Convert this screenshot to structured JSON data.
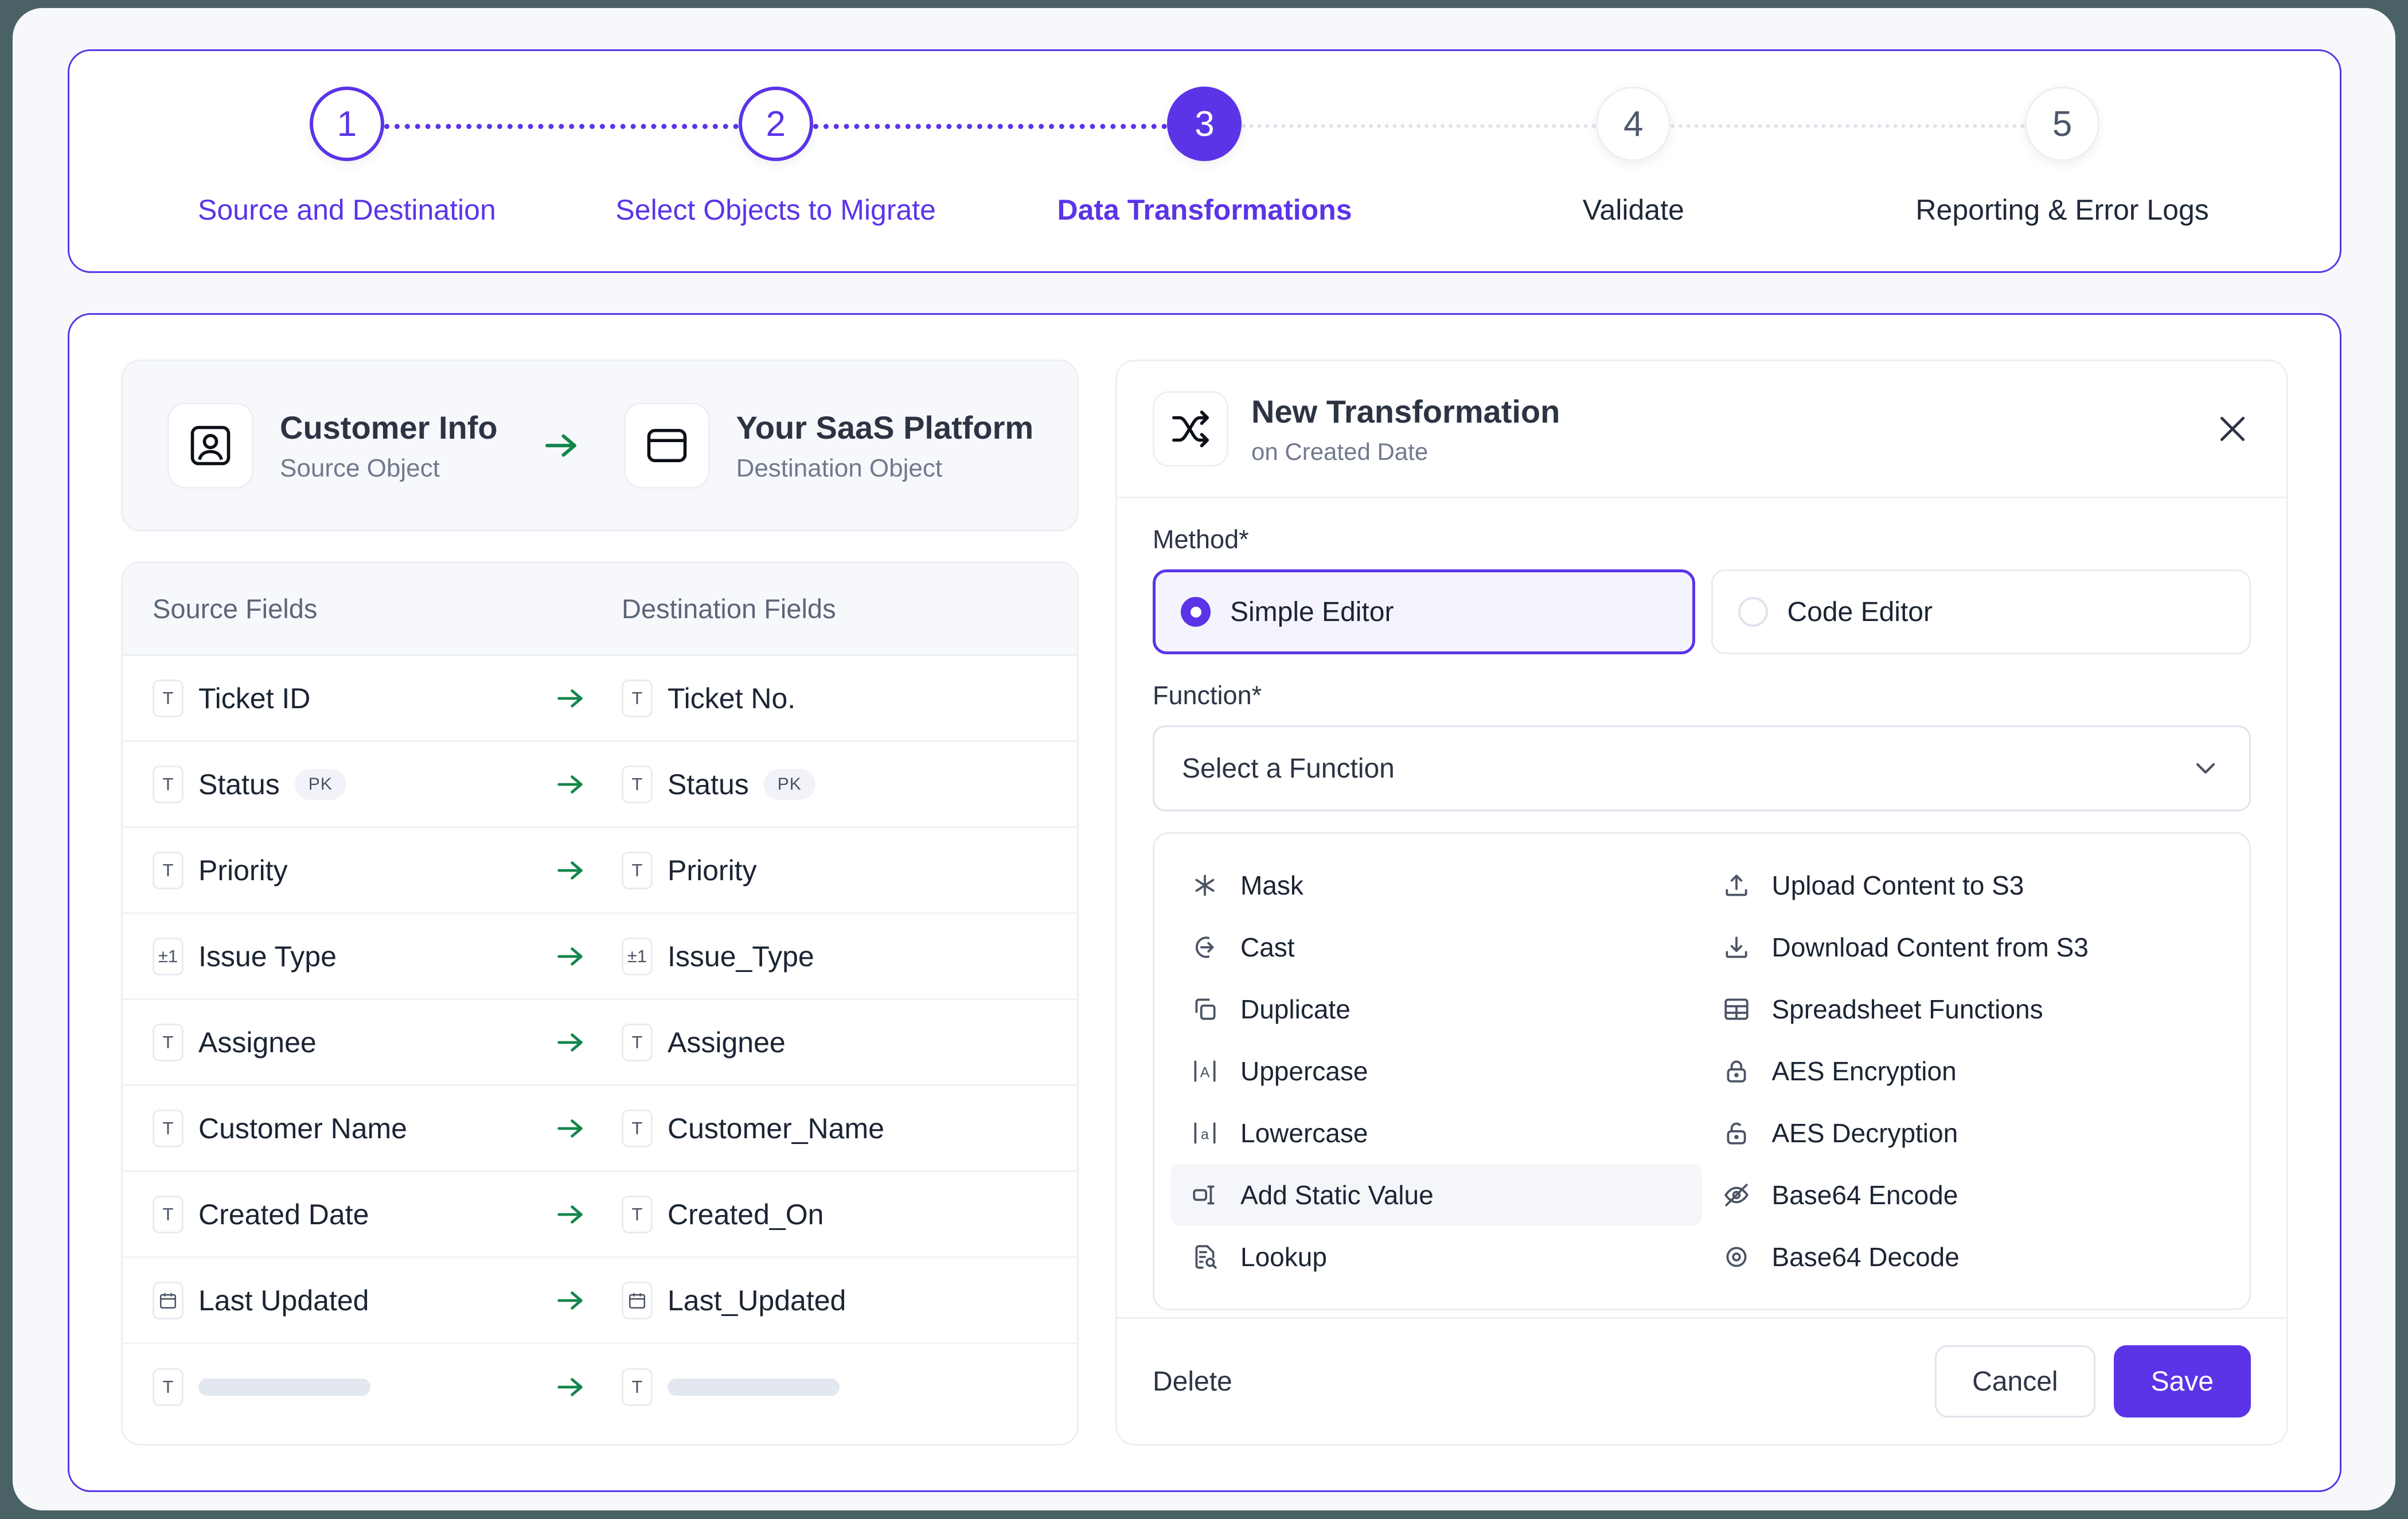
{
  "theme": {
    "accent": "#5b34e8",
    "arrow_green": "#13864b",
    "page_bg": "#4a6166",
    "surface": "#f6f8fc"
  },
  "stepper": {
    "steps": [
      {
        "number": "1",
        "label": "Source and Destination",
        "state": "done"
      },
      {
        "number": "2",
        "label": "Select Objects to Migrate",
        "state": "done"
      },
      {
        "number": "3",
        "label": "Data Transformations",
        "state": "active"
      },
      {
        "number": "4",
        "label": "Validate",
        "state": "todo"
      },
      {
        "number": "5",
        "label": "Reporting & Error Logs",
        "state": "todo"
      }
    ]
  },
  "mapping": {
    "source_object": {
      "name": "Customer Info",
      "subtitle": "Source Object",
      "icon": "user-square-icon"
    },
    "destination_object": {
      "name": "Your SaaS Platform",
      "subtitle": "Destination Object",
      "icon": "database-card-icon"
    },
    "columns": {
      "source": "Source Fields",
      "destination": "Destination Fields"
    },
    "rows": [
      {
        "source": {
          "name": "Ticket ID",
          "type": "T",
          "pk": false
        },
        "destination": {
          "name": "Ticket No.",
          "type": "T",
          "pk": false
        }
      },
      {
        "source": {
          "name": "Status",
          "type": "T",
          "pk": true,
          "pk_label": "PK"
        },
        "destination": {
          "name": "Status",
          "type": "T",
          "pk": true,
          "pk_label": "PK"
        }
      },
      {
        "source": {
          "name": "Priority",
          "type": "T",
          "pk": false
        },
        "destination": {
          "name": "Priority",
          "type": "T",
          "pk": false
        }
      },
      {
        "source": {
          "name": "Issue Type",
          "type": "±1",
          "pk": false
        },
        "destination": {
          "name": "Issue_Type",
          "type": "±1",
          "pk": false
        }
      },
      {
        "source": {
          "name": "Assignee",
          "type": "T",
          "pk": false
        },
        "destination": {
          "name": "Assignee",
          "type": "T",
          "pk": false
        }
      },
      {
        "source": {
          "name": "Customer Name",
          "type": "T",
          "pk": false
        },
        "destination": {
          "name": "Customer_Name",
          "type": "T",
          "pk": false
        }
      },
      {
        "source": {
          "name": "Created Date",
          "type": "T",
          "pk": false
        },
        "destination": {
          "name": "Created_On",
          "type": "T",
          "pk": false
        }
      },
      {
        "source": {
          "name": "Last Updated",
          "type": "cal",
          "pk": false
        },
        "destination": {
          "name": "Last_Updated",
          "type": "cal",
          "pk": false
        }
      },
      {
        "source": {
          "name": "",
          "type": "T",
          "pk": false,
          "skeleton": true
        },
        "destination": {
          "name": "",
          "type": "T",
          "pk": false,
          "skeleton": true
        }
      }
    ]
  },
  "transformation_panel": {
    "title": "New Transformation",
    "subtitle": "on Created Date",
    "icon": "shuffle-icon",
    "close_icon": "close-icon",
    "method_label": "Method*",
    "methods": [
      {
        "label": "Simple Editor",
        "selected": true
      },
      {
        "label": "Code Editor",
        "selected": false
      }
    ],
    "function_label": "Function*",
    "function_value": "Select a Function",
    "function_caret": "chevron-down-icon",
    "functions_left": [
      {
        "label": "Mask",
        "icon": "asterisk-icon",
        "highlight": false
      },
      {
        "label": "Cast",
        "icon": "arrow-right-circle-icon",
        "highlight": false
      },
      {
        "label": "Duplicate",
        "icon": "copy-icon",
        "highlight": false
      },
      {
        "label": "Uppercase",
        "icon": "uppercase-a-icon",
        "highlight": false
      },
      {
        "label": "Lowercase",
        "icon": "lowercase-a-icon",
        "highlight": false
      },
      {
        "label": "Add Static Value",
        "icon": "add-static-value-icon",
        "highlight": true
      },
      {
        "label": "Lookup",
        "icon": "file-search-icon",
        "highlight": false
      }
    ],
    "functions_right": [
      {
        "label": "Upload Content to S3",
        "icon": "upload-icon",
        "highlight": false
      },
      {
        "label": "Download Content from S3",
        "icon": "download-icon",
        "highlight": false
      },
      {
        "label": "Spreadsheet Functions",
        "icon": "table-icon",
        "highlight": false
      },
      {
        "label": "AES Encryption",
        "icon": "lock-closed-icon",
        "highlight": false
      },
      {
        "label": "AES Decryption",
        "icon": "lock-open-icon",
        "highlight": false
      },
      {
        "label": "Base64 Encode",
        "icon": "eye-off-icon",
        "highlight": false
      },
      {
        "label": "Base64 Decode",
        "icon": "eye-icon",
        "highlight": false
      }
    ],
    "footer": {
      "delete_label": "Delete",
      "cancel_label": "Cancel",
      "save_label": "Save"
    }
  }
}
